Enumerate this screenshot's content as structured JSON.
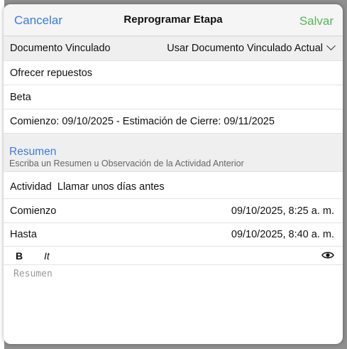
{
  "header": {
    "cancel_label": "Cancelar",
    "title": "Reprogramar Etapa",
    "save_label": "Salvar"
  },
  "linked_document": {
    "label": "Documento Vinculado",
    "value": "Usar Documento Vinculado Actual"
  },
  "info_rows": [
    "Ofrecer repuestos",
    "Beta",
    "Comienzo: 09/10/2025 - Estimación de Cierre: 09/11/2025"
  ],
  "summary": {
    "title": "Resumen",
    "subtitle": "Escriba un Resumen u Observación de la Actividad Anterior",
    "activity": "Actividad  Llamar unos días antes",
    "start_label": "Comienzo",
    "start_value": "09/10/2025, 8:25 a. m.",
    "end_label": "Hasta",
    "end_value": "09/10/2025, 8:40 a. m."
  },
  "toolbar": {
    "bold": "B",
    "italic": "It"
  },
  "editor": {
    "placeholder": "Resumen",
    "value": ""
  },
  "colors": {
    "accent": "#3b7be0",
    "save": "#5ab55a"
  },
  "icons": {
    "toolbar_right": "eye-icon",
    "dropdown": "chevron-down-icon"
  }
}
